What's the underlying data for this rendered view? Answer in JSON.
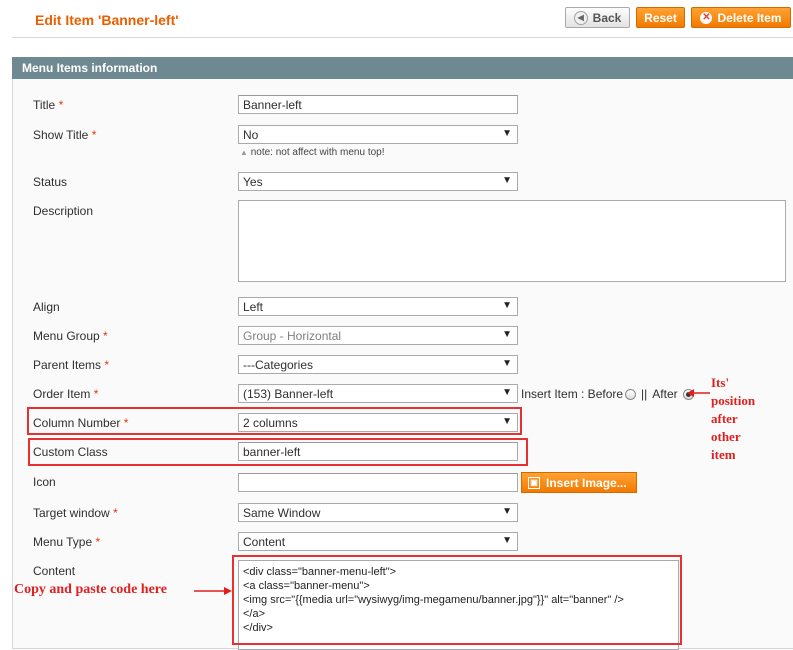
{
  "header": {
    "title": "Edit Item 'Banner-left'",
    "back_label": "Back",
    "reset_label": "Reset",
    "delete_label": "Delete Item"
  },
  "section": {
    "title": "Menu Items information"
  },
  "fields": {
    "title": {
      "label": "Title",
      "value": "Banner-left"
    },
    "show_title": {
      "label": "Show Title",
      "value": "No",
      "note": "note: not affect with menu top!"
    },
    "status": {
      "label": "Status",
      "value": "Yes"
    },
    "description": {
      "label": "Description",
      "value": ""
    },
    "align": {
      "label": "Align",
      "value": "Left"
    },
    "menu_group": {
      "label": "Menu Group",
      "value": "Group - Horizontal"
    },
    "parent_items": {
      "label": "Parent Items",
      "value": "---Categories"
    },
    "order_item": {
      "label": "Order Item",
      "value": "(153) Banner-left",
      "insert_label": "Insert Item : Before",
      "separator": "||",
      "after_label": "After",
      "selected": "After"
    },
    "column_number": {
      "label": "Column Number",
      "value": "2 columns"
    },
    "custom_class": {
      "label": "Custom Class",
      "value": "banner-left"
    },
    "icon": {
      "label": "Icon",
      "value": "",
      "button_label": "Insert Image..."
    },
    "target_window": {
      "label": "Target window",
      "value": "Same Window"
    },
    "menu_type": {
      "label": "Menu Type",
      "value": "Content"
    },
    "content": {
      "label": "Content",
      "lines": [
        "<div class=\"banner-menu-left\">",
        "<a class=\"banner-menu\">",
        "<img src=\"{{media url=\"wysiwyg/img-megamenu/banner.jpg\"}}\" alt=\"banner\" />",
        "</a>",
        "</div>"
      ]
    },
    "required_mark": "*"
  },
  "annotations": {
    "position_note": [
      "Its'",
      "position",
      "after",
      "other",
      "item"
    ],
    "paste_note": "Copy and paste code here"
  },
  "colors": {
    "accent": "#eb5e00",
    "header_bar": "#6f8992",
    "annotation": "#e53131"
  }
}
